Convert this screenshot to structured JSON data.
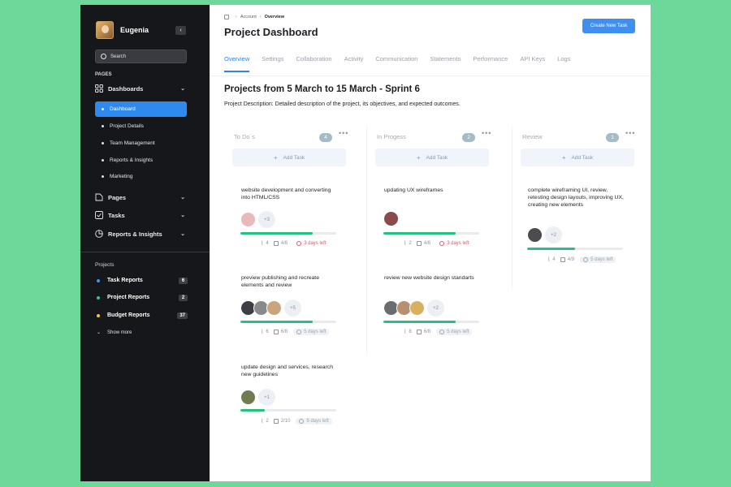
{
  "sidebar": {
    "user_name": "Eugenia",
    "collapse_icon": "‹",
    "search_placeholder": "Search",
    "pages_label": "PAGES",
    "nav": {
      "dashboards": "Dashboards",
      "pages": "Pages",
      "tasks": "Tasks",
      "reports": "Reports & Insights"
    },
    "dashboard_items": [
      "Dashboard",
      "Project Details",
      "Team Management",
      "Reports & Insights",
      "Marketing"
    ],
    "projects_label": "Projects",
    "projects": [
      {
        "name": "Task Reports",
        "count": "6",
        "color": "#3b95f2"
      },
      {
        "name": "Project Reports",
        "count": "2",
        "color": "#36c880"
      },
      {
        "name": "Budget Reports",
        "count": "37",
        "color": "#f2c83b"
      }
    ],
    "show_more": "Show more"
  },
  "header": {
    "breadcrumb": [
      "Account",
      "Overview"
    ],
    "title": "Project Dashboard",
    "create_button": "Create New Task"
  },
  "tabs": [
    "Overview",
    "Settings",
    "Collaboration",
    "Activity",
    "Communication",
    "Statements",
    "Performance",
    "API Keys",
    "Logs"
  ],
  "sprint": {
    "title": "Projects from 5 March to 15 March - Sprint 6",
    "description": "Project Description: Detailed description of the project, its objectives, and expected outcomes."
  },
  "columns": [
    {
      "name": "To Do´s",
      "count": "4",
      "add_label": "Add Task",
      "cards": [
        {
          "title": "website development and converting into HTML/CSS",
          "more": "+3",
          "progress": 0.75,
          "attachments": "4",
          "checklist": "4/8",
          "due": "3 days left",
          "due_state": "red",
          "avatars": [
            "#e9b9b9"
          ]
        },
        {
          "title": "preview publishing and recreate elements and review",
          "more": "+5",
          "progress": 0.75,
          "attachments": "6",
          "checklist": "6/8",
          "due": "5 days left",
          "due_state": "gray",
          "avatars": [
            "#3d3f44",
            "#8a8a8a",
            "#c9a47d"
          ]
        },
        {
          "title": "update design and services, research new guidelines",
          "more": "+1",
          "progress": 0.25,
          "attachments": "2",
          "checklist": "2/10",
          "due": "5 days left",
          "due_state": "gray",
          "avatars": [
            "#6f7d4e"
          ]
        }
      ]
    },
    {
      "name": "In Progess",
      "count": "2",
      "add_label": "Add Task",
      "cards": [
        {
          "title": "updating UX wireframes",
          "more": "",
          "progress": 0.75,
          "attachments": "2",
          "checklist": "4/8",
          "due": "3 days left",
          "due_state": "red",
          "avatars": [
            "#8c4a4a"
          ]
        },
        {
          "title": "review new website design standarts",
          "more": "+2",
          "progress": 0.75,
          "attachments": "8",
          "checklist": "6/8",
          "due": "5 days left",
          "due_state": "gray",
          "avatars": [
            "#6a6c70",
            "#b89070",
            "#d8b060"
          ]
        }
      ]
    },
    {
      "name": "Review",
      "count": "1",
      "add_label": "Add Task",
      "cards": [
        {
          "title": "complete wireframing UI, review, retesting design layouts, improving UX, creating new elements",
          "more": "+2",
          "progress": 0.5,
          "attachments": "4",
          "checklist": "4/9",
          "due": "5 days left",
          "due_state": "gray",
          "avatars": [
            "#4a4c50"
          ]
        }
      ]
    }
  ],
  "colors": {
    "accent": "#2f84e6",
    "sidebar_bg": "#16171a",
    "active_nav": "#2f8af0",
    "progress": "#25c17e",
    "due_red": "#e65566"
  }
}
